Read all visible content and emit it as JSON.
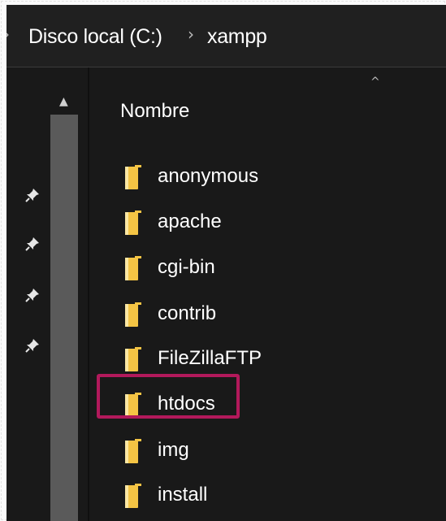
{
  "breadcrumb": {
    "items": [
      "Disco local (C:)",
      "xampp"
    ]
  },
  "list": {
    "column_header": "Nombre",
    "folders": [
      "anonymous",
      "apache",
      "cgi-bin",
      "contrib",
      "FileZillaFTP",
      "htdocs",
      "img",
      "install"
    ],
    "highlighted_folder": "htdocs"
  },
  "colors": {
    "window_bg": "#191919",
    "folder": "#f4c444",
    "highlight": "#b2195b",
    "scrollbar": "#5a5a5a"
  },
  "icons": {
    "pinned_count": 4,
    "pin": "pin-icon",
    "folder": "folder-icon"
  }
}
